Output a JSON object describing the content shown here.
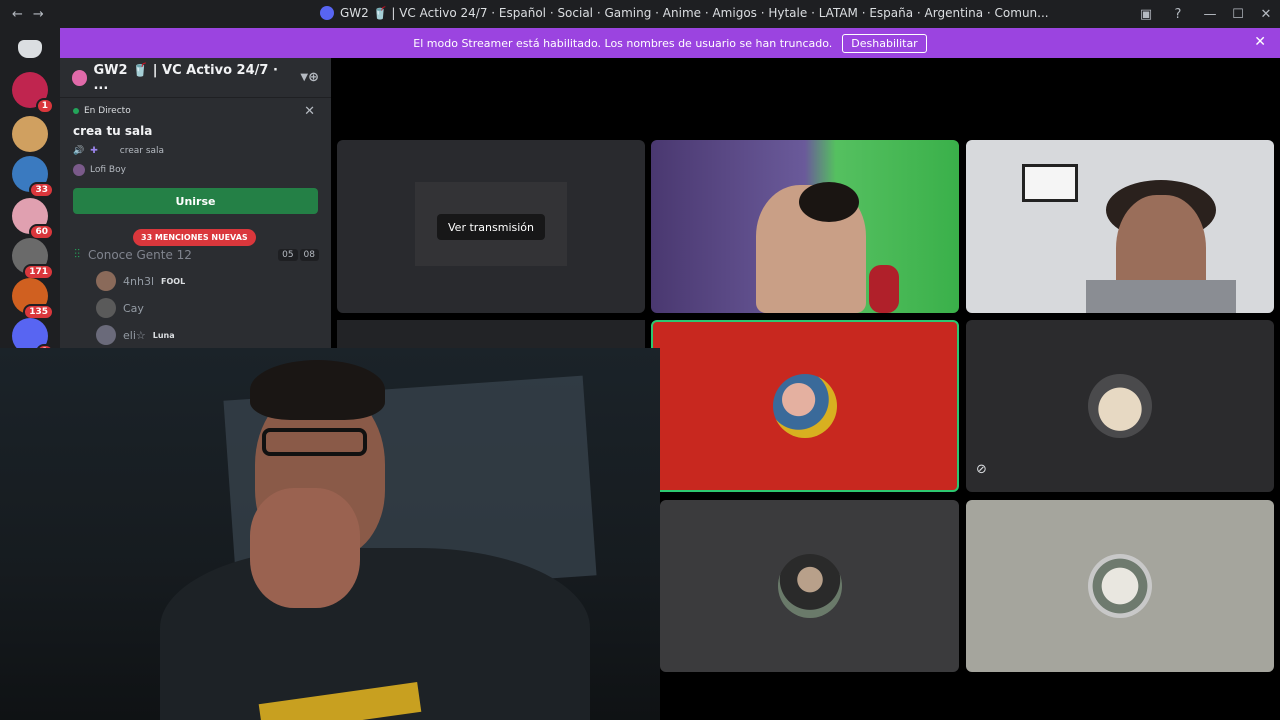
{
  "window": {
    "title": "GW2 🥤 | VC Activo 24/7 · Español · Social · Gaming · Anime · Amigos · Hytale · LATAM · España · Argentina · Comun...",
    "nav_back": "←",
    "nav_forward": "→",
    "controls": {
      "minimize": "—",
      "maximize": "☐",
      "close": "✕",
      "inbox": "▣",
      "help": "?"
    }
  },
  "banner": {
    "text": "El modo Streamer está habilitado. Los nombres de usuario se han truncado.",
    "button": "Deshabilitar",
    "close": "✕"
  },
  "rail": {
    "servers": [
      {
        "badge": "1",
        "color": "#c0254f"
      },
      {
        "badge": "",
        "color": "#d0a060"
      },
      {
        "badge": "33",
        "color": "#3a7ac0"
      },
      {
        "badge": "60",
        "color": "#e0a0b0"
      },
      {
        "badge": "171",
        "color": "#6a6a6a"
      },
      {
        "badge": "135",
        "color": "#d06020"
      },
      {
        "badge": "1",
        "color": "#5865f2"
      }
    ]
  },
  "sidebar": {
    "server_name": "GW2 🥤 | VC Activo 24/7 · ...",
    "live_status": "En Directo",
    "stage_name": "crea tu sala",
    "stage_channel": "crear sala",
    "stage_user": "Lofi Boy",
    "join_button": "Unirse",
    "mentions_badge": "33 MENCIONES NUEVAS",
    "voice_channel": "Conoce Gente 12",
    "count_a": "05",
    "count_b": "08",
    "users": [
      {
        "name": "4nh3l",
        "tag": "FOOL"
      },
      {
        "name": "Cay",
        "tag": ""
      },
      {
        "name": "eli☆",
        "tag": "Luna"
      }
    ]
  },
  "stage": {
    "watch_button": "Ver transmisión"
  },
  "colors": {
    "accent": "#9b44e0",
    "join": "#248046",
    "mention": "#da373c",
    "speaking": "#2dc770"
  }
}
